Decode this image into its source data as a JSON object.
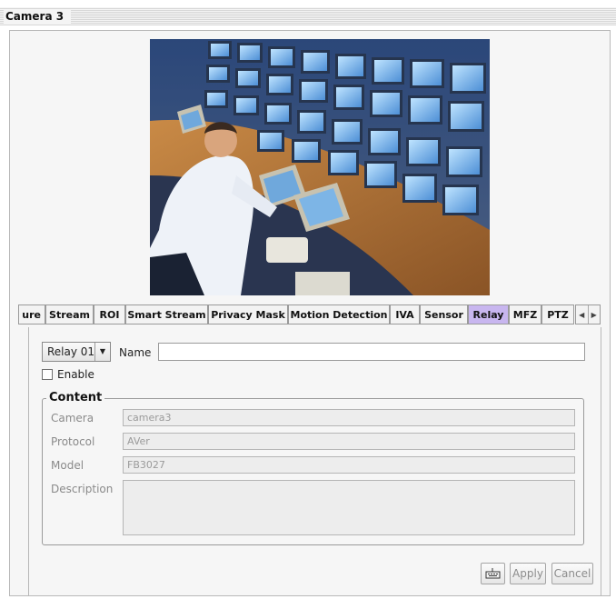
{
  "window": {
    "title": "Camera 3"
  },
  "tabs": [
    {
      "label": "ure",
      "active": false
    },
    {
      "label": "Stream",
      "active": false
    },
    {
      "label": "ROI",
      "active": false
    },
    {
      "label": "Smart Stream",
      "active": false
    },
    {
      "label": "Privacy Mask",
      "active": false
    },
    {
      "label": "Motion Detection",
      "active": false
    },
    {
      "label": "IVA",
      "active": false
    },
    {
      "label": "Sensor",
      "active": false
    },
    {
      "label": "Relay",
      "active": true
    },
    {
      "label": "MFZ",
      "active": false
    },
    {
      "label": "PTZ",
      "active": false
    }
  ],
  "relay": {
    "selected": "Relay 01",
    "name_label": "Name",
    "name_value": "",
    "enable_label": "Enable",
    "enable_checked": false
  },
  "content": {
    "legend": "Content",
    "camera_label": "Camera",
    "camera_value": "camera3",
    "protocol_label": "Protocol",
    "protocol_value": "AVer",
    "model_label": "Model",
    "model_value": "FB3027",
    "description_label": "Description",
    "description_value": ""
  },
  "buttons": {
    "keyboard_icon": "keyboard-icon",
    "apply": "Apply",
    "cancel": "Cancel"
  },
  "colors": {
    "active_tab": "#c8b6ef",
    "panel_bg": "#f6f6f6"
  }
}
